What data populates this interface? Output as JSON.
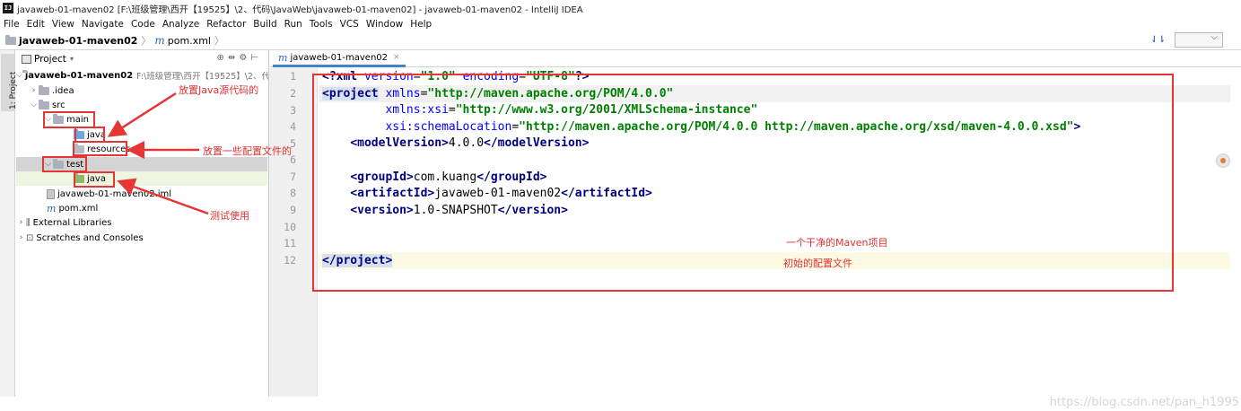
{
  "window": {
    "icon_text": "IJ",
    "title": "javaweb-01-maven02 [F:\\班级管理\\西开【19525】\\2、代码\\JavaWeb\\javaweb-01-maven02] - javaweb-01-maven02 - IntelliJ IDEA"
  },
  "menu": [
    "File",
    "Edit",
    "View",
    "Navigate",
    "Code",
    "Analyze",
    "Refactor",
    "Build",
    "Run",
    "Tools",
    "VCS",
    "Window",
    "Help"
  ],
  "navbar": {
    "project": "javaweb-01-maven02",
    "file": "pom.xml"
  },
  "toolstrip": {
    "label": "1: Project"
  },
  "project_panel": {
    "title": "Project",
    "tree": [
      {
        "label": "javaweb-01-maven02",
        "hint": "F:\\班级管理\\西开【19525】\\2、代",
        "arrow": "v",
        "icon": "folder",
        "bold": true
      },
      {
        "label": ".idea",
        "arrow": ">",
        "icon": "folder"
      },
      {
        "label": "src",
        "arrow": "v",
        "icon": "folder"
      },
      {
        "label": "main",
        "arrow": "v",
        "icon": "folder"
      },
      {
        "label": "java",
        "arrow": "",
        "icon": "folder-blue"
      },
      {
        "label": "resources",
        "arrow": "",
        "icon": "folder-res"
      },
      {
        "label": "test",
        "arrow": "v",
        "icon": "folder"
      },
      {
        "label": "java",
        "arrow": "",
        "icon": "folder-green"
      },
      {
        "label": "javaweb-01-maven02.iml",
        "arrow": "",
        "icon": "iml"
      },
      {
        "label": "pom.xml",
        "arrow": "",
        "icon": "maven"
      },
      {
        "label": "External Libraries",
        "arrow": ">",
        "icon": "libraries"
      },
      {
        "label": "Scratches and Consoles",
        "arrow": ">",
        "icon": "scratches"
      }
    ]
  },
  "annotations": {
    "java_source": "放置Java源代码的",
    "config_files": "放置一些配置文件的",
    "testing": "测试使用",
    "clean_project": "一个干净的Maven项目",
    "initial_config": "初始的配置文件"
  },
  "editor": {
    "tab_label": "javaweb-01-maven02",
    "line_numbers": [
      "1",
      "2",
      "3",
      "4",
      "5",
      "6",
      "7",
      "8",
      "9",
      "10",
      "11",
      "12"
    ],
    "xml_decl": {
      "lt": "<?",
      "name": "xml",
      "a1": "version",
      "v1": "\"1.0\"",
      "a2": "encoding",
      "v2": "\"UTF-8\"",
      "end": "?>"
    },
    "project_open": "<project",
    "xmlns_attr": "xmlns",
    "xmlns_val": "\"http://maven.apache.org/POM/4.0.0\"",
    "xsi_attr": "xmlns:xsi",
    "xsi_val": "\"http://www.w3.org/2001/XMLSchema-instance\"",
    "schema_attr": "xsi:schemaLocation",
    "schema_val": "\"http://maven.apache.org/POM/4.0.0 http://maven.apache.org/xsd/maven-4.0.0.xsd\"",
    "model_open": "<modelVersion>",
    "model_val": "4.0.0",
    "model_close": "</modelVersion>",
    "group_open": "<groupId>",
    "group_val": "com.kuang",
    "group_close": "</groupId>",
    "artifact_open": "<artifactId>",
    "artifact_val": "javaweb-01-maven02",
    "artifact_close": "</artifactId>",
    "version_open": "<version>",
    "version_val": "1.0-SNAPSHOT",
    "version_close": "</version>",
    "project_close": "</project>"
  },
  "watermark": "https://blog.csdn.net/pan_h1995"
}
